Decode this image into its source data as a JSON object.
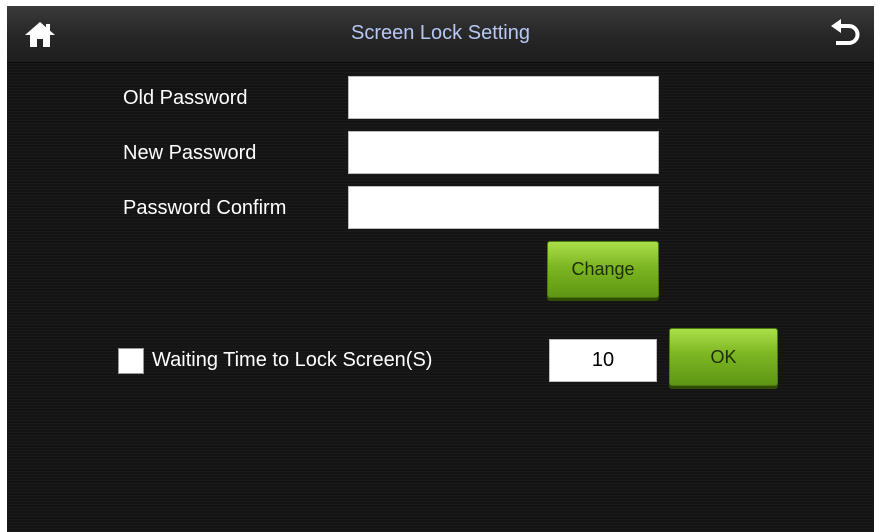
{
  "header": {
    "title": "Screen Lock Setting",
    "home_icon": "home-icon",
    "back_icon": "back-arrow-icon"
  },
  "password_form": {
    "old_password_label": "Old Password",
    "old_password_value": "",
    "new_password_label": "New Password",
    "new_password_value": "",
    "confirm_label": "Password Confirm",
    "confirm_value": "",
    "change_button_label": "Change"
  },
  "lock_timer": {
    "checkbox_checked": false,
    "label": "Waiting Time to Lock Screen(S)",
    "value": "10",
    "ok_button_label": "OK"
  },
  "colors": {
    "background": "#141414",
    "title_text": "#b7c8f5",
    "button_green": "#7db623"
  }
}
